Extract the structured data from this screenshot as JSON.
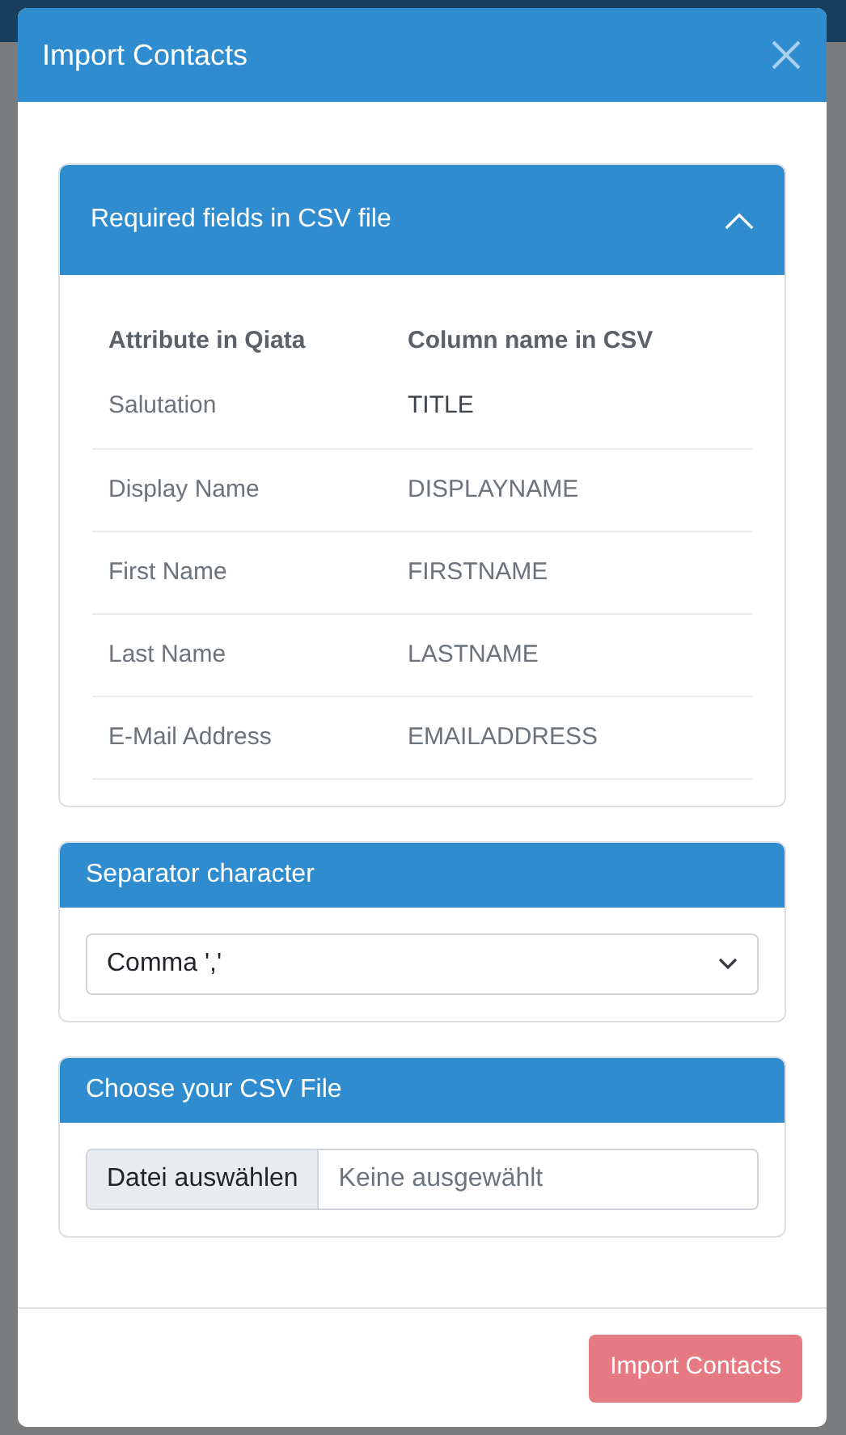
{
  "dialog": {
    "title": "Import Contacts"
  },
  "required_fields": {
    "title": "Required fields in CSV file",
    "expanded": true,
    "columns": [
      "Attribute in Qiata",
      "Column name in CSV"
    ],
    "rows": [
      {
        "attribute": "Salutation",
        "column": "TITLE"
      },
      {
        "attribute": "Display Name",
        "column": "DISPLAYNAME"
      },
      {
        "attribute": "First Name",
        "column": "FIRSTNAME"
      },
      {
        "attribute": "Last Name",
        "column": "LASTNAME"
      },
      {
        "attribute": "E-Mail Address",
        "column": "EMAILADDRESS"
      }
    ]
  },
  "separator": {
    "title": "Separator character",
    "value": "Comma ','"
  },
  "file": {
    "title": "Choose your CSV File",
    "button": "Datei auswählen",
    "placeholder": "Keine ausgewählt"
  },
  "footer": {
    "button": "Import Contacts",
    "disabled": true
  }
}
